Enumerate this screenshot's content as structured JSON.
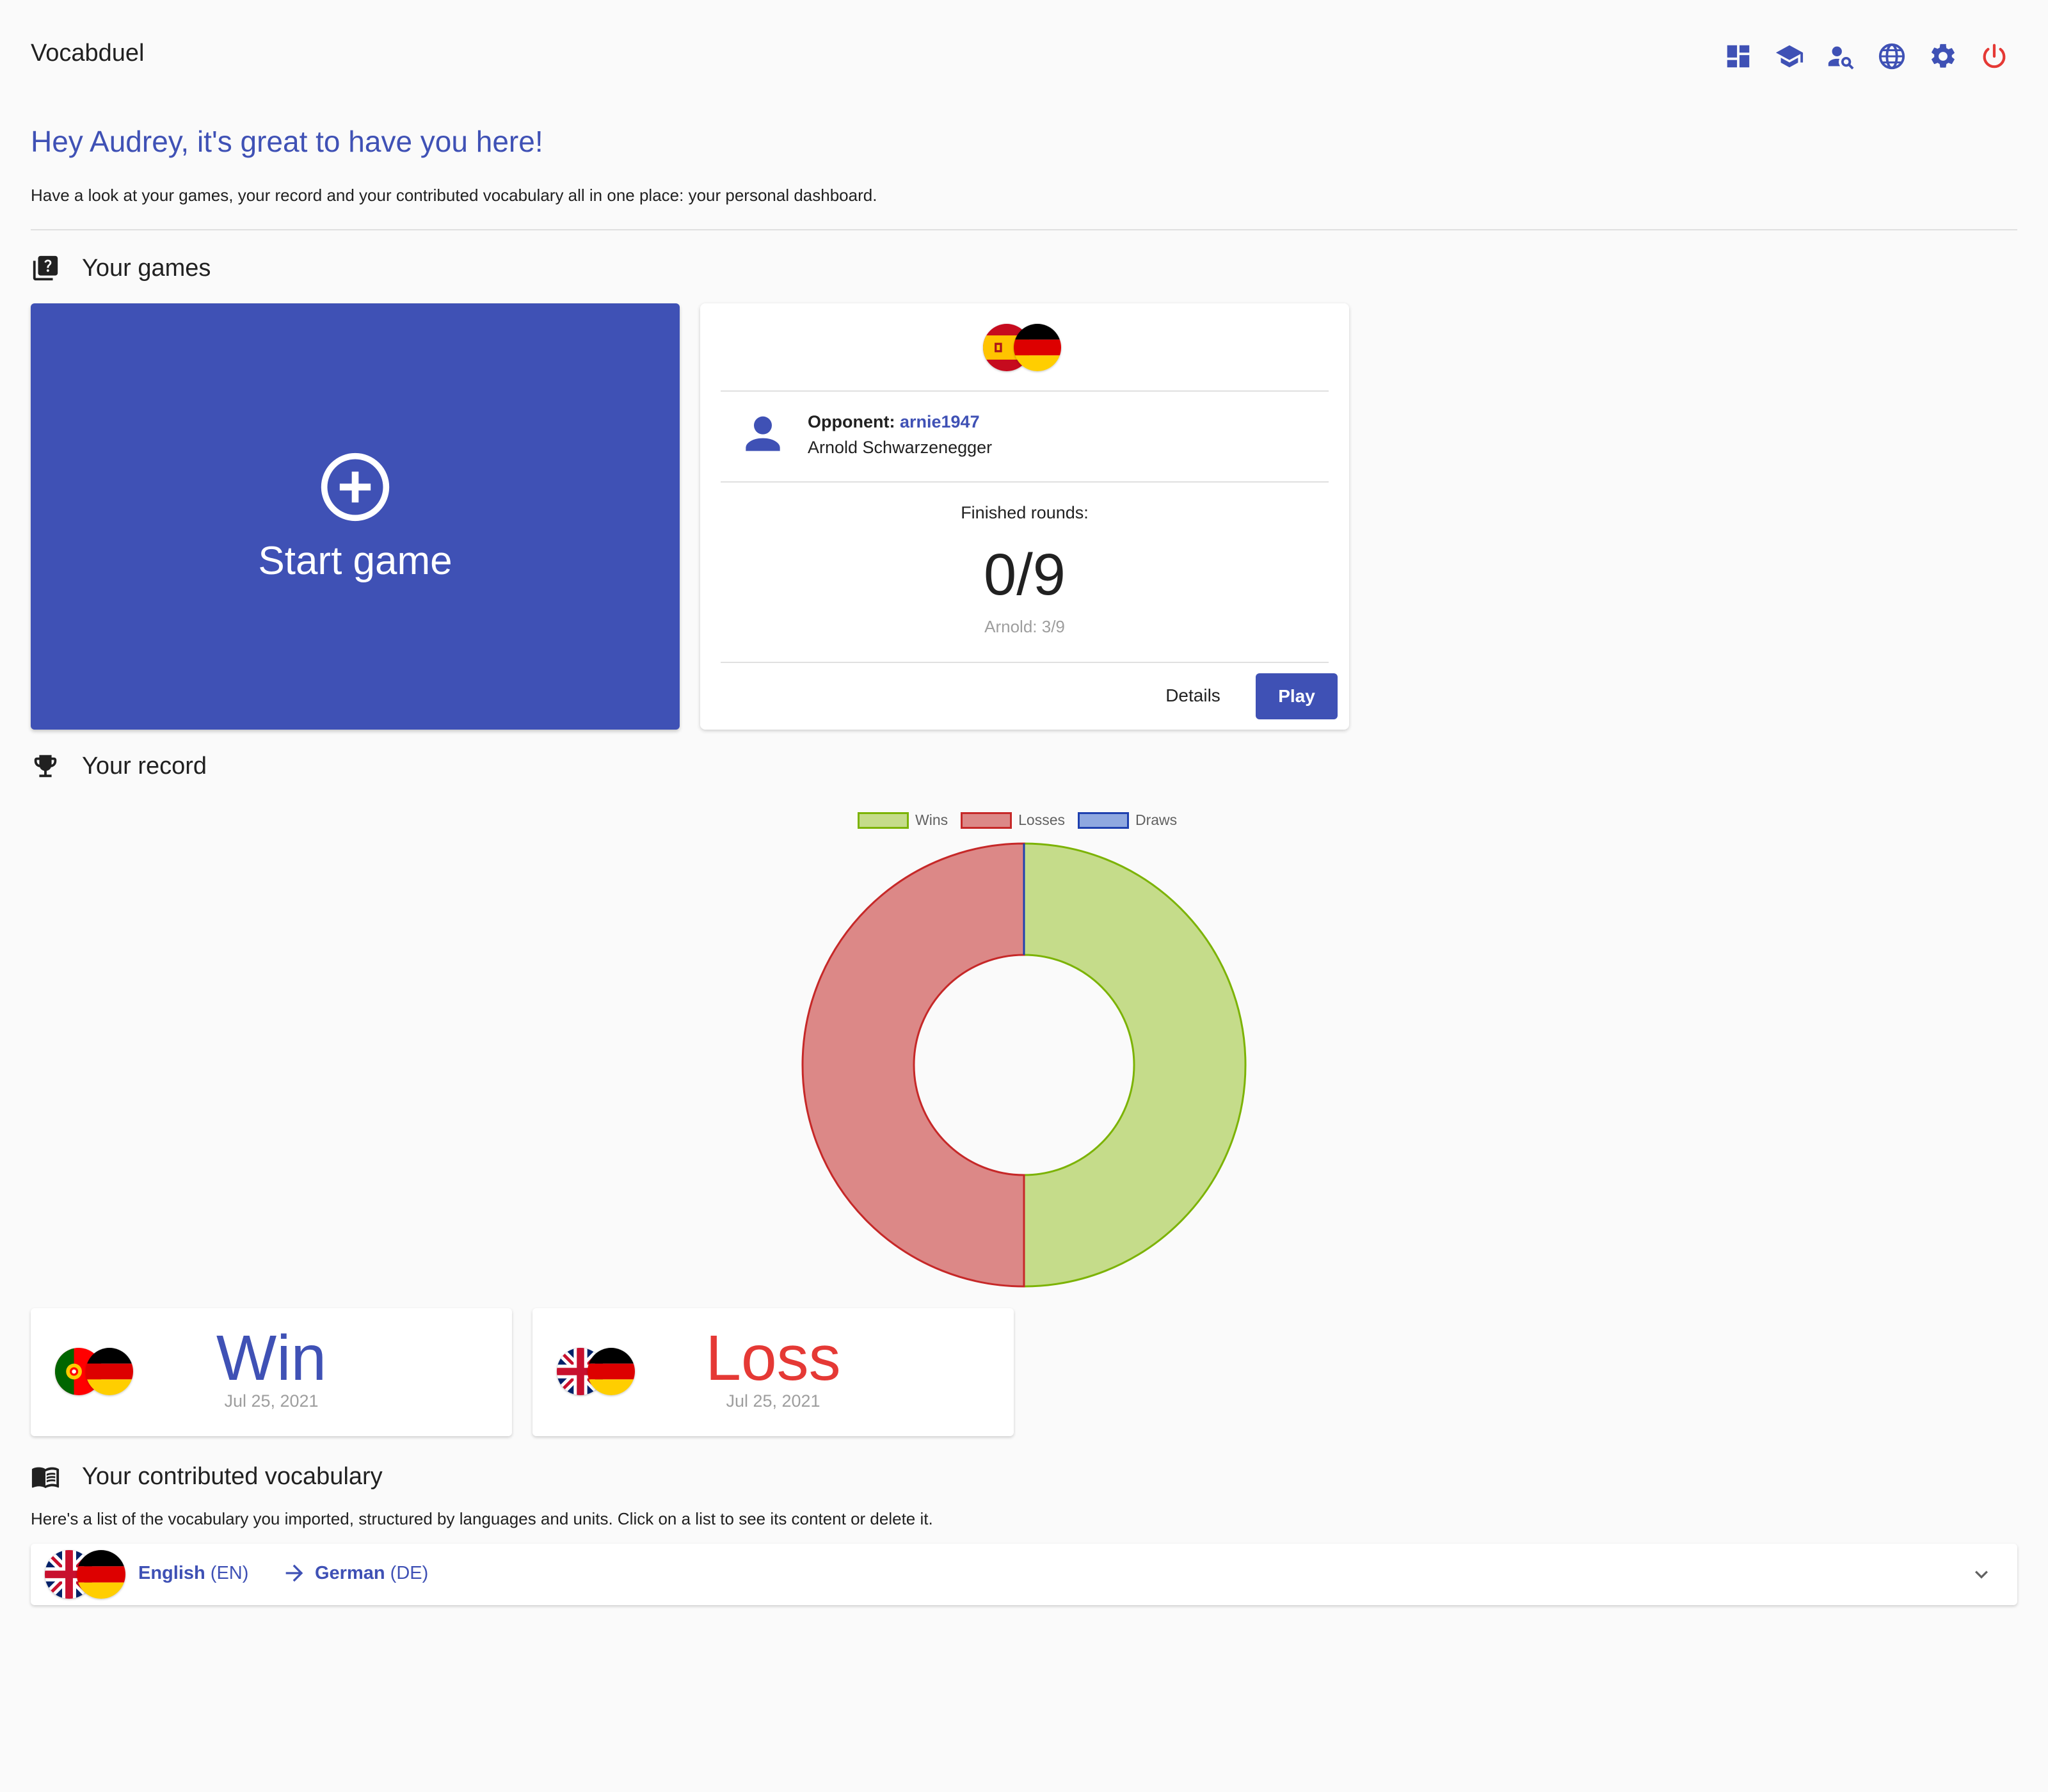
{
  "app": {
    "title": "Vocabduel"
  },
  "topnav": {
    "icons": [
      {
        "name": "dashboard-icon",
        "color": "#3f51b5"
      },
      {
        "name": "school-icon",
        "color": "#3f51b5"
      },
      {
        "name": "user-search-icon",
        "color": "#3f51b5"
      },
      {
        "name": "globe-icon",
        "color": "#3f51b5"
      },
      {
        "name": "gear-icon",
        "color": "#3f51b5"
      },
      {
        "name": "power-icon",
        "color": "#e53935"
      }
    ]
  },
  "header": {
    "greeting": "Hey Audrey, it's great to have you here!",
    "intro": "Have a look at your games, your record and your contributed vocabulary all in one place: your personal dashboard."
  },
  "games": {
    "title": "Your games",
    "start_label": "Start game",
    "current": {
      "flags": [
        "es",
        "de"
      ],
      "opponent_label": "Opponent:",
      "opponent_username": "arnie1947",
      "opponent_name": "Arnold Schwarzenegger",
      "finished_label": "Finished rounds:",
      "finished_value": "0/9",
      "opponent_progress": "Arnold: 3/9",
      "details_label": "Details",
      "play_label": "Play"
    }
  },
  "record": {
    "title": "Your record",
    "results": [
      {
        "flags": [
          "pt",
          "de"
        ],
        "result": "Win",
        "date": "Jul 25, 2021",
        "color": "#3f51b5"
      },
      {
        "flags": [
          "gb",
          "de"
        ],
        "result": "Loss",
        "date": "Jul 25, 2021",
        "color": "#e53935"
      }
    ]
  },
  "chart_data": {
    "type": "pie",
    "variant": "doughnut",
    "categories": [
      "Wins",
      "Losses",
      "Draws"
    ],
    "values": [
      1,
      1,
      0
    ],
    "colors": {
      "Wins": {
        "fill": "#c5dc8a",
        "border": "#7cb305"
      },
      "Losses": {
        "fill": "#dc8887",
        "border": "#c62828"
      },
      "Draws": {
        "fill": "#8fa8e0",
        "border": "#1e40af"
      }
    },
    "legend": "top"
  },
  "vocab": {
    "title": "Your contributed vocabulary",
    "intro": "Here's a list of the vocabulary you imported, structured by languages and units. Click on a list to see its content or delete it.",
    "lists": [
      {
        "flags": [
          "gb",
          "de"
        ],
        "from_name": "English",
        "from_code": "(EN)",
        "to_name": "German",
        "to_code": "(DE)"
      }
    ]
  }
}
